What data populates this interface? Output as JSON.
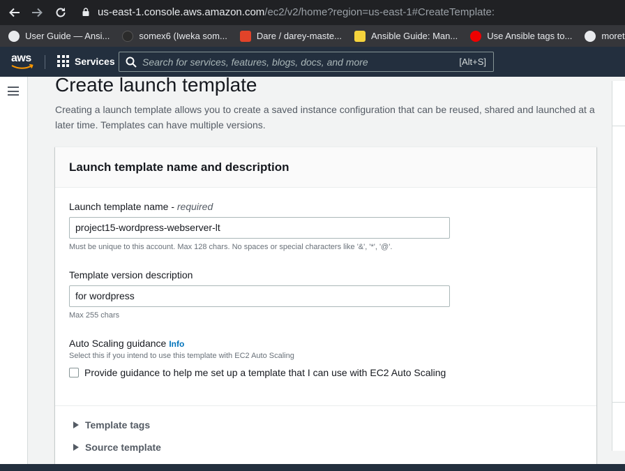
{
  "browser": {
    "url_host": "us-east-1.console.aws.amazon.com",
    "url_path": "/ec2/v2/home?region=us-east-1#CreateTemplate:",
    "bookmarks": [
      {
        "label": "User Guide — Ansi...",
        "color": "#e8eaed"
      },
      {
        "label": "somex6 (Iweka som...",
        "color": "#2b2b2b"
      },
      {
        "label": "Dare / darey-maste...",
        "color": "#e24329"
      },
      {
        "label": "Ansible Guide: Man...",
        "color": "#f5d33c"
      },
      {
        "label": "Use Ansible tags to...",
        "color": "#ee0000"
      },
      {
        "label": "morethancertified/...",
        "color": "#e8eaed"
      }
    ]
  },
  "awsnav": {
    "logo_text": "aws",
    "services_label": "Services",
    "search_placeholder": "Search for services, features, blogs, docs, and more",
    "search_shortcut": "[Alt+S]"
  },
  "page": {
    "title": "Create launch template",
    "description": "Creating a launch template allows you to create a saved instance configuration that can be reused, shared and launched at a later time. Templates can have multiple versions."
  },
  "section": {
    "title": "Launch template name and description",
    "name_label": "Launch template name - ",
    "name_required": "required",
    "name_value": "project15-wordpress-webserver-lt",
    "name_hint": "Must be unique to this account. Max 128 chars. No spaces or special characters like '&', '*', '@'.",
    "desc_label": "Template version description",
    "desc_value": "for wordpress",
    "desc_hint": "Max 255 chars",
    "asg_label": "Auto Scaling guidance",
    "asg_info": "Info",
    "asg_hint": "Select this if you intend to use this template with EC2 Auto Scaling",
    "asg_checkbox_label": "Provide guidance to help me set up a template that I can use with EC2 Auto Scaling",
    "asg_checked": false
  },
  "expanders": [
    {
      "label": "Template tags"
    },
    {
      "label": "Source template"
    }
  ]
}
